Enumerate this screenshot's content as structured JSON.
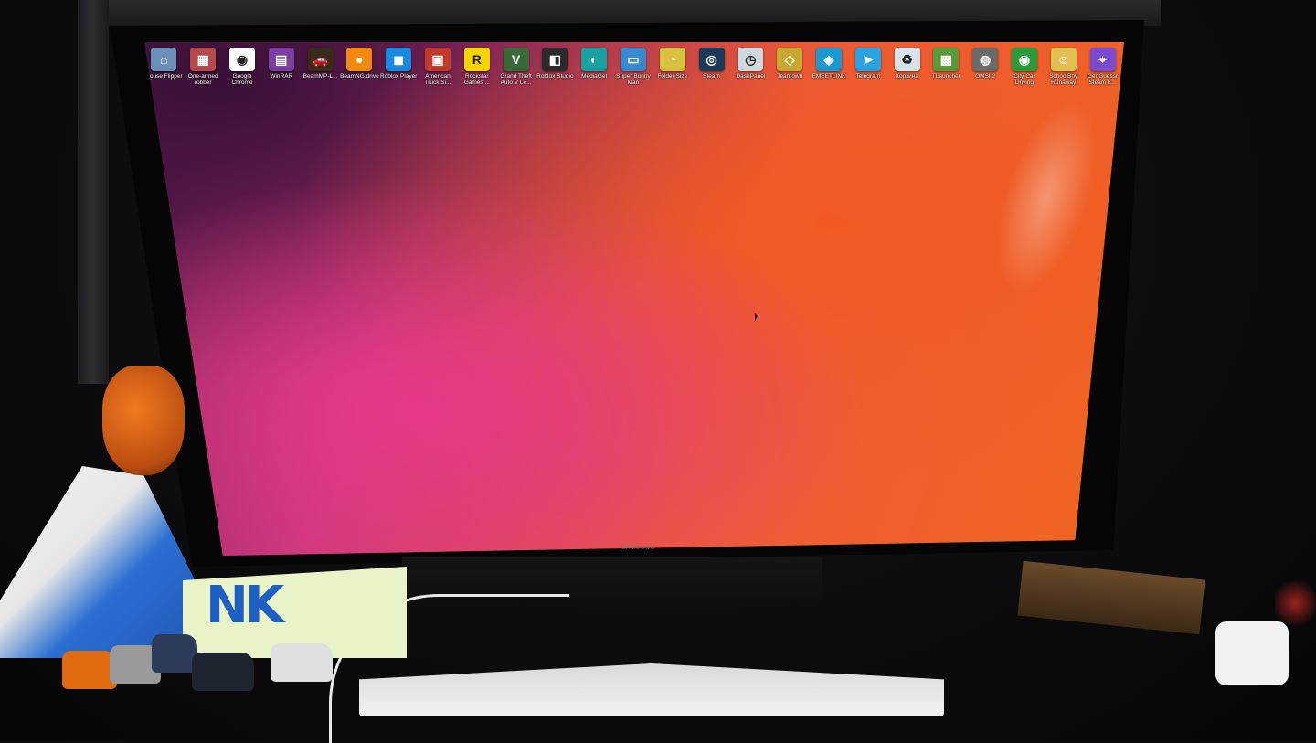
{
  "scene": {
    "monitor_brand": "SAMSUNG"
  },
  "desktop": {
    "wallpaper_colors": [
      "#5a1a4a",
      "#e63a86",
      "#f0661e"
    ],
    "icons": [
      {
        "label": "House Flipper",
        "icon": "house-flipper-icon",
        "color": "#6c8fb8",
        "glyph": "⌂"
      },
      {
        "label": "One-armed robber",
        "icon": "one-armed-robber-icon",
        "color": "#b54a4a",
        "glyph": "▦"
      },
      {
        "label": "Google Chrome",
        "icon": "chrome-icon",
        "color": "#ffffff",
        "glyph": "◉"
      },
      {
        "label": "WinRAR",
        "icon": "winrar-icon",
        "color": "#7a3fa0",
        "glyph": "▤"
      },
      {
        "label": "BeamMP-L...",
        "icon": "beammp-icon",
        "color": "#3a2a1a",
        "glyph": "🚗"
      },
      {
        "label": "BeamNG.drive",
        "icon": "beamng-icon",
        "color": "#f28a10",
        "glyph": "●"
      },
      {
        "label": "Roblox Player",
        "icon": "roblox-player-icon",
        "color": "#1a8ae0",
        "glyph": "◼"
      },
      {
        "label": "American Truck Si...",
        "icon": "ats-icon",
        "color": "#c23a2a",
        "glyph": "▣"
      },
      {
        "label": "Rockstar Games ...",
        "icon": "rockstar-icon",
        "color": "#f5d400",
        "glyph": "R"
      },
      {
        "label": "Grand Theft Auto V Le...",
        "icon": "gta5-icon",
        "color": "#3a6a3a",
        "glyph": "V"
      },
      {
        "label": "Roblox Studio",
        "icon": "roblox-studio-icon",
        "color": "#2a2a2a",
        "glyph": "◧"
      },
      {
        "label": "MediaGet",
        "icon": "mediaget-icon",
        "color": "#1aa0a0",
        "glyph": "◐"
      },
      {
        "label": "Super Bunny Man",
        "icon": "super-bunny-man-icon",
        "color": "#3a8ad0",
        "glyph": "▭"
      },
      {
        "label": "Folder Size",
        "icon": "folder-size-icon",
        "color": "#d8c040",
        "glyph": "◔"
      },
      {
        "label": "Steam",
        "icon": "steam-icon",
        "color": "#1b3a5a",
        "glyph": "◎"
      },
      {
        "label": "DashPanel",
        "icon": "dashpanel-icon",
        "color": "#cfd8dc",
        "glyph": "◷"
      },
      {
        "label": "Teardown",
        "icon": "teardown-icon",
        "color": "#c8a830",
        "glyph": "◇"
      },
      {
        "label": "EMEETLINK",
        "icon": "emeetlink-icon",
        "color": "#1a9ad0",
        "glyph": "◈"
      },
      {
        "label": "Telegram",
        "icon": "telegram-icon",
        "color": "#2aa3e0",
        "glyph": "➤"
      },
      {
        "label": "Корзина",
        "icon": "recycle-bin-icon",
        "color": "#d8e4ec",
        "glyph": "♻"
      },
      {
        "label": "TLauncher",
        "icon": "tlauncher-icon",
        "color": "#5a9a3a",
        "glyph": "▩"
      },
      {
        "label": "OMSI 2",
        "icon": "omsi2-icon",
        "color": "#6a6a6a",
        "glyph": "◍"
      },
      {
        "label": "City Car Driving",
        "icon": "city-car-driving-icon",
        "color": "#2a9a3a",
        "glyph": "◉"
      },
      {
        "label": "SchoolBoy Runaway",
        "icon": "schoolboy-runaway-icon",
        "color": "#e0c050",
        "glyph": "☺"
      },
      {
        "label": "GeoGuessr Steam E...",
        "icon": "geoguessr-icon",
        "color": "#7a4ad0",
        "glyph": "⌖"
      }
    ]
  }
}
